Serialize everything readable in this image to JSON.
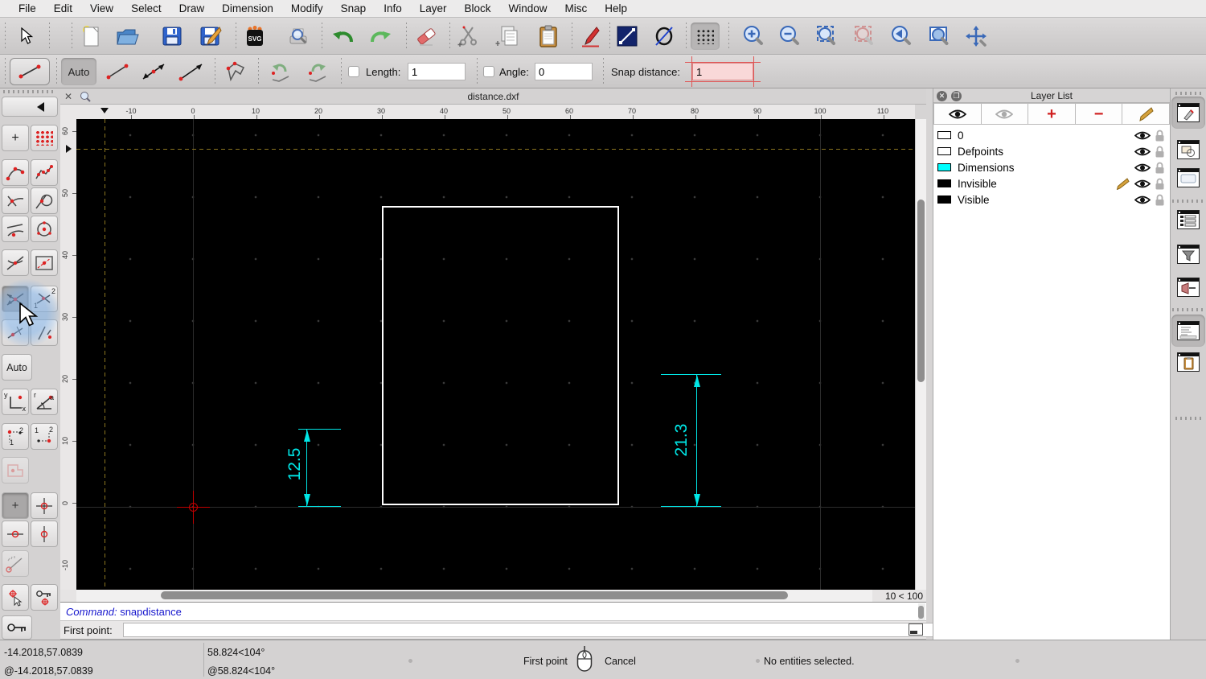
{
  "window": {
    "menu": [
      "File",
      "Edit",
      "View",
      "Select",
      "Draw",
      "Dimension",
      "Modify",
      "Snap",
      "Info",
      "Layer",
      "Block",
      "Window",
      "Misc",
      "Help"
    ]
  },
  "toolbar": {
    "svg_label": "SVG"
  },
  "options": {
    "auto_label": "Auto",
    "length_label": "Length:",
    "length_value": "1",
    "angle_label": "Angle:",
    "angle_value": "0",
    "snap_label": "Snap distance:",
    "snap_value": "1"
  },
  "snap_toolbar": {
    "auto_label": "Auto",
    "one": "1",
    "two": "2",
    "cart_y": "y",
    "cart_x": "x",
    "polar_r": "r",
    "polar_a": "a"
  },
  "document": {
    "title": "distance.dxf",
    "ruler_x": [
      "-10",
      "0",
      "10",
      "20",
      "30",
      "40",
      "50",
      "60",
      "70",
      "80",
      "90",
      "100",
      "110"
    ],
    "ruler_y": [
      "60",
      "50",
      "40",
      "30",
      "20",
      "10",
      "0",
      "-10"
    ],
    "dim_left": "12.5",
    "dim_right": "21.3",
    "grid_status": "10 < 100"
  },
  "command": {
    "label": "Command:",
    "value": "snapdistance",
    "prompt": "First point:"
  },
  "layer_list": {
    "title": "Layer List",
    "layers": [
      {
        "name": "0",
        "color": "#ffffff"
      },
      {
        "name": "Defpoints",
        "color": "#ffffff"
      },
      {
        "name": "Dimensions",
        "color": "#00ffff"
      },
      {
        "name": "Invisible",
        "color": "#000000"
      },
      {
        "name": "Visible",
        "color": "#000000"
      }
    ]
  },
  "status": {
    "abs": "-14.2018,57.0839",
    "rel": "@-14.2018,57.0839",
    "abs_polar": "58.824<104°",
    "rel_polar": "@58.824<104°",
    "mouse_left": "First point",
    "mouse_right": "Cancel",
    "selection": "No entities selected."
  },
  "colors": {
    "dimension_cyan": "#00e7e7",
    "command_blue": "#1515cd",
    "snap_highlight_pink": "#f9d8d8",
    "snap_highlight_red": "#e05555",
    "crosshair_orange": "#8a7520",
    "origin_red": "#c00000"
  }
}
